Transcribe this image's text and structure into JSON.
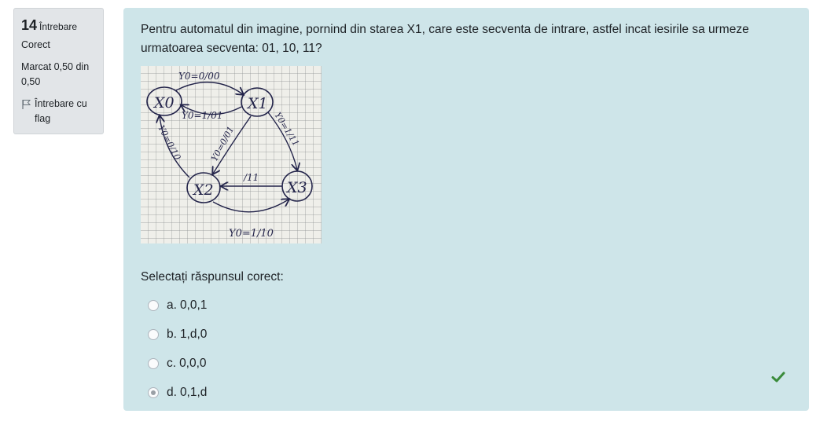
{
  "info": {
    "number": "14",
    "question_word": "Întrebare",
    "state": "Corect",
    "grade": "Marcat 0,50 din 0,50",
    "flag_label": "Întrebare cu flag"
  },
  "question": {
    "text": "Pentru automatul din imagine, pornind din starea X1, care este secventa de intrare, astfel incat iesirile sa urmeze urmatoarea secventa: 01, 10, 11?",
    "figure": {
      "states": [
        "X0",
        "X1",
        "X2",
        "X3"
      ],
      "transition_labels": [
        "Y0=0/00",
        "Y0=1/01",
        "Y0=1/11",
        "Y0=0/10",
        "Y0=0/01",
        "/11",
        "Y0=1/10"
      ]
    },
    "prompt": "Selectați răspunsul corect:",
    "options": [
      {
        "letter": "a.",
        "text": "0,0,1",
        "selected": false
      },
      {
        "letter": "b.",
        "text": "1,d,0",
        "selected": false
      },
      {
        "letter": "c.",
        "text": "0,0,0",
        "selected": false
      },
      {
        "letter": "d.",
        "text": "0,1,d",
        "selected": true
      }
    ],
    "feedback_icon": "checkmark-icon",
    "colors": {
      "content_bg": "#cee5e9",
      "info_bg": "#e2e5e8",
      "correct": "#3a8b3a"
    }
  }
}
